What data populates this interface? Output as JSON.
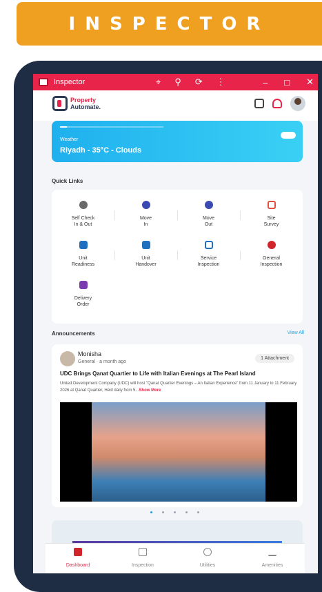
{
  "banner": {
    "title": "INSPECTOR"
  },
  "window": {
    "title": "Inspector",
    "icons": [
      "location-icon",
      "zoom-icon",
      "rotate-icon",
      "more-icon"
    ],
    "controls": [
      "minimize",
      "maximize",
      "close"
    ]
  },
  "header": {
    "logo_line1": "Property",
    "logo_line2": "Automate."
  },
  "weather": {
    "label": "Weather",
    "city": "Riyadh - 35°C - Clouds"
  },
  "quick_links": {
    "title": "Quick Links",
    "items": [
      {
        "label": "Self Check\nIn & Out",
        "color": "#6a6a6a"
      },
      {
        "label": "Move\nIn",
        "color": "#3a4ab0"
      },
      {
        "label": "Move\nOut",
        "color": "#3a4ab0"
      },
      {
        "label": "Site\nSurvey",
        "color": "#e05040"
      },
      {
        "label": "Unit\nReadiness",
        "color": "#1e6fc0"
      },
      {
        "label": "Unit\nHandover",
        "color": "#1e6fc0"
      },
      {
        "label": "Service\nInspection",
        "color": "#1e6fc0"
      },
      {
        "label": "General\nInspection",
        "color": "#d0252a"
      },
      {
        "label": "Delivery\nOrder",
        "color": "#7a3ab0"
      }
    ]
  },
  "announcements": {
    "title": "Announcements",
    "view_all": "View All",
    "post": {
      "author": "Monisha",
      "category": "General",
      "time": "a month ago",
      "attachment": "1 Attachment",
      "headline": "UDC Brings Qanat Quartier to Life with Italian Evenings at The Pearl Island",
      "body": "United Development Company (UDC) will host \"Qanat Quartier Evenings – An Italian Experience\" from 11 January to 11 February 2026 at Qanat Quartier, Held daily from 5...",
      "show_more": "Show More"
    }
  },
  "tabs": [
    {
      "label": "Dashboard",
      "active": true
    },
    {
      "label": "Inspection",
      "active": false
    },
    {
      "label": "Utilities",
      "active": false
    },
    {
      "label": "Amenities",
      "active": false
    }
  ]
}
